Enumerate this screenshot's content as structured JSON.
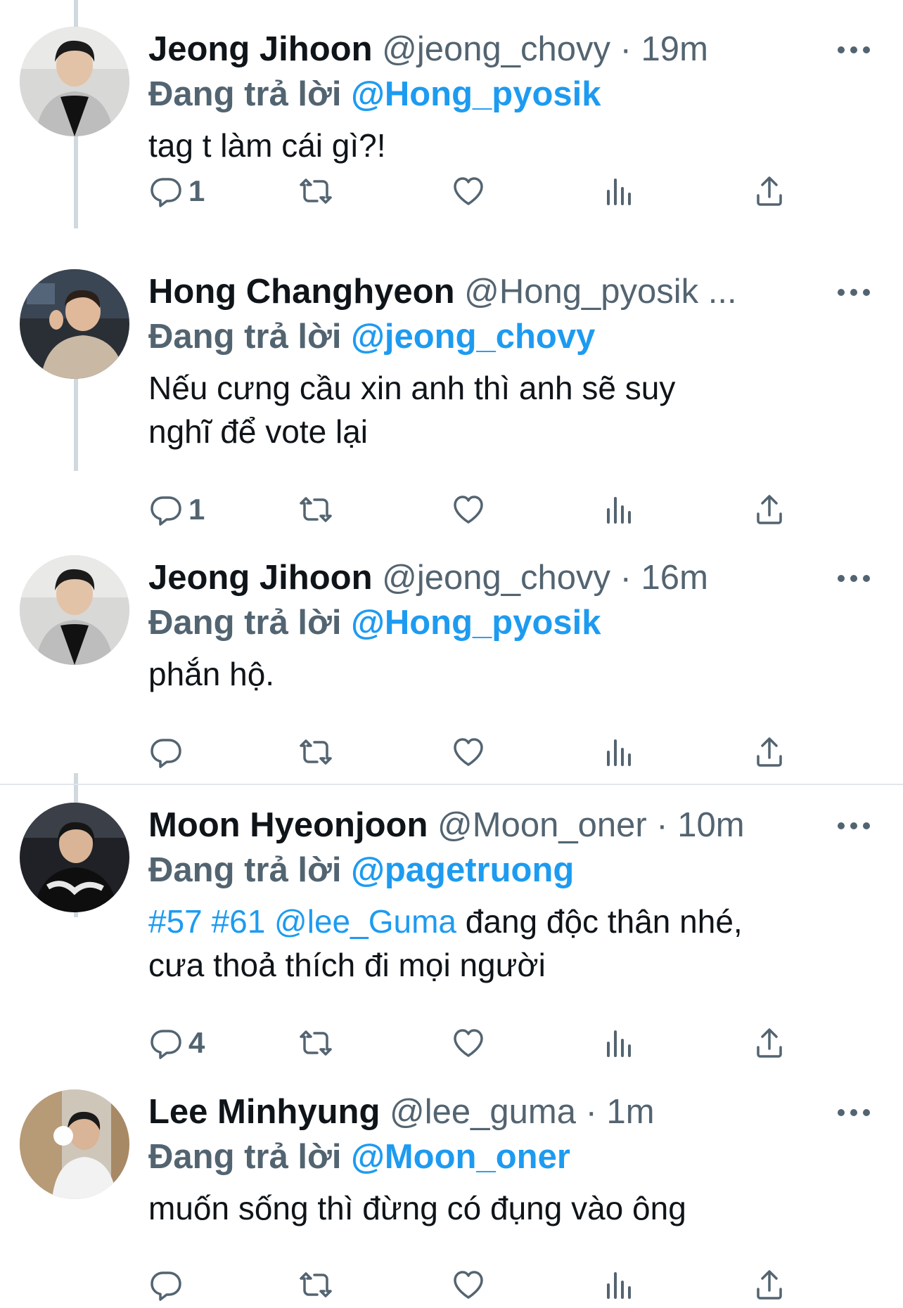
{
  "reply_prefix": "Đang trả lời",
  "tweets": [
    {
      "name": "Jeong Jihoon",
      "handle": "@jeong_chovy",
      "time": " · 19m",
      "reply_to": "@Hong_pyosik",
      "text": "tag t làm cái gì?!",
      "reply_count": "1"
    },
    {
      "name": "Hong Changhyeon",
      "handle": "@Hong_pyosik ...",
      "time": "",
      "reply_to": "@jeong_chovy",
      "text": "Nếu cưng cầu xin anh thì anh sẽ suy\nnghĩ để vote lại",
      "reply_count": "1"
    },
    {
      "name": "Jeong Jihoon",
      "handle": "@jeong_chovy",
      "time": " · 16m",
      "reply_to": "@Hong_pyosik",
      "text": "phắn hộ.",
      "reply_count": ""
    },
    {
      "name": "Moon Hyeonjoon",
      "handle": "@Moon_oner",
      "time": " · 10m",
      "reply_to": "@pagetruong",
      "text_links": "#57 #61 @lee_Guma",
      "text": " đang độc thân nhé,\ncưa thoả thích đi mọi người",
      "reply_count": "4"
    },
    {
      "name": "Lee Minhyung",
      "handle": "@lee_guma",
      "time": " · 1m",
      "reply_to": "@Moon_oner",
      "text": "muốn sống thì đừng có đụng vào ông",
      "reply_count": ""
    }
  ],
  "icons": {
    "reply": "reply-icon",
    "retweet": "retweet-icon",
    "like": "heart-icon",
    "views": "analytics-icon",
    "share": "share-icon",
    "more": "more-icon"
  },
  "colors": {
    "link": "#1d9bf0",
    "secondary": "#536471",
    "text": "#0f1419",
    "thread": "#cfd9de"
  }
}
